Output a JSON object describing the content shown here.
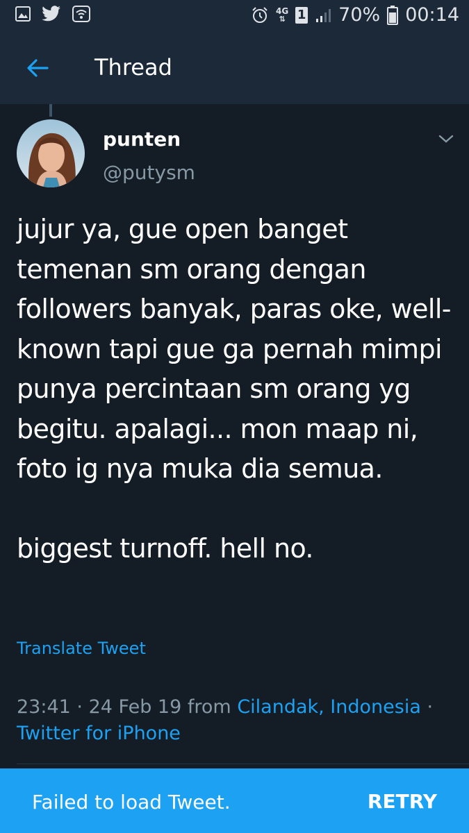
{
  "status_bar": {
    "battery": "70%",
    "time": "00:14",
    "network": "4G",
    "sim_slot": "1",
    "icons": [
      "gallery-icon",
      "twitter-icon",
      "wifi-icon",
      "alarm-icon",
      "signal-icon",
      "battery-icon"
    ]
  },
  "header": {
    "title": "Thread",
    "back_icon": "arrow-left-icon",
    "accent": "#1da1f2"
  },
  "tweet": {
    "name": "punten",
    "handle": "@putysm",
    "text": "jujur ya, gue open banget temenan sm orang dengan followers banyak, paras oke, well-known tapi gue ga pernah mimpi punya percintaan sm orang yg begitu. apalagi... mon maap ni, foto ig nya muka dia semua.\n\nbiggest turnoff. hell no.",
    "translate_label": "Translate Tweet",
    "time": "23:41",
    "date": "24 Feb 19",
    "from_label": "from",
    "location": "Cilandak, Indonesia",
    "source": "Twitter for iPhone",
    "separator": "·"
  },
  "snackbar": {
    "message": "Failed to load Tweet.",
    "action": "RETRY",
    "color": "#1da1f2"
  },
  "colors": {
    "background": "#141d26",
    "bar": "#1c2938",
    "secondary_text": "#8899a6"
  }
}
